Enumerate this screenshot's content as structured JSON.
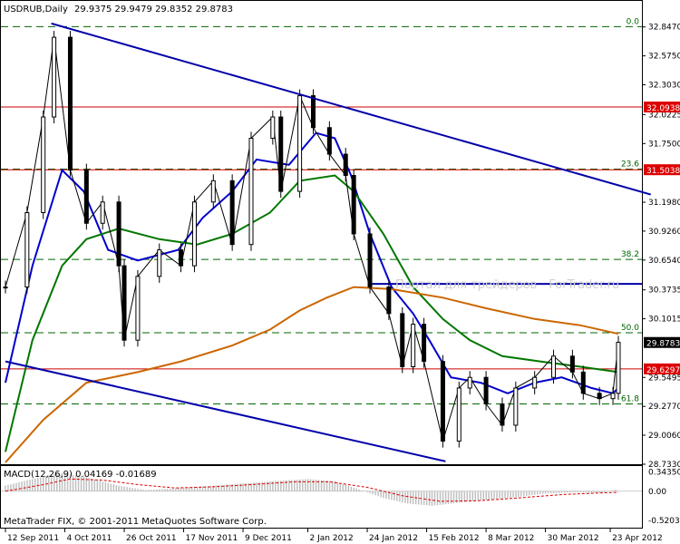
{
  "header": {
    "symbol_label": "USDRUB,Daily",
    "ohlc_label": "29.9375 29.9479 29.8352 29.8783"
  },
  "watermark": "Портал для трейдеров - ForTrader.ru",
  "footer_credit": "MetaTrader FIX, © 2001-2011 MetaQuotes Software Corp.",
  "macd_label": "MACD(12,26,9) 0.04169 -0.01689",
  "colors": {
    "background": "#ffffff",
    "frame": "#000000",
    "candle": "#000000",
    "ma_fast": "#0000cc",
    "ma_mid": "#007700",
    "ma_slow": "#cc6600",
    "channel": "#0000aa",
    "horizontal_level": "#cc0000",
    "fib_level": "#006600",
    "price_tag_red": "#dd0000",
    "price_tag_black": "#000000",
    "macd_histogram": "#c0c0c0",
    "macd_signal": "#dd0000",
    "watermark": "#cccccc"
  },
  "chart_data": {
    "type": "candlestick",
    "title": "USDRUB,Daily",
    "y_range": [
      28.733,
      32.93
    ],
    "y_axis_ticks": [
      "32.8470",
      "32.5750",
      "32.3030",
      "32.0225",
      "31.7500",
      "31.1980",
      "30.9260",
      "30.6540",
      "30.3735",
      "30.1015",
      "29.5495",
      "29.2770",
      "29.0060",
      "28.7330"
    ],
    "x_axis_ticks": [
      "12 Sep 2011",
      "4 Oct 2011",
      "26 Oct 2011",
      "17 Nov 2011",
      "9 Dec 2011",
      "2 Jan 2012",
      "24 Jan 2012",
      "15 Feb 2012",
      "8 Mar 2012",
      "30 Mar 2012",
      "23 Apr 2012"
    ],
    "price_tags": [
      {
        "label": "32.0938",
        "value": 32.0938,
        "style": "red"
      },
      {
        "label": "31.5038",
        "value": 31.5038,
        "style": "red"
      },
      {
        "label": "29.8783",
        "value": 29.8783,
        "style": "black"
      },
      {
        "label": "29.6297",
        "value": 29.6297,
        "style": "red"
      }
    ],
    "horizontal_levels": [
      32.0938,
      31.5038,
      29.6297
    ],
    "blue_support_level": 30.43,
    "fibonacci_levels": [
      {
        "label": "0.0",
        "value": 32.85
      },
      {
        "label": "23.6",
        "value": 31.51
      },
      {
        "label": "38.2",
        "value": 30.66
      },
      {
        "label": "50.0",
        "value": 29.97
      },
      {
        "label": "61.8",
        "value": 29.3
      }
    ],
    "channel_upper": {
      "from": {
        "x": "2011-09-29",
        "y": 32.88
      },
      "to": {
        "x": "2012-05-08",
        "y": 31.27
      }
    },
    "channel_lower": {
      "from": {
        "x": "2011-09-12",
        "y": 29.7
      },
      "to": {
        "x": "2012-02-22",
        "y": 28.76
      }
    },
    "close_series": [
      {
        "x": "2011-09-12",
        "y": 30.4
      },
      {
        "x": "2011-09-20",
        "y": 31.1
      },
      {
        "x": "2011-09-26",
        "y": 32.0
      },
      {
        "x": "2011-09-30",
        "y": 32.75
      },
      {
        "x": "2011-10-06",
        "y": 31.5
      },
      {
        "x": "2011-10-12",
        "y": 31.0
      },
      {
        "x": "2011-10-18",
        "y": 31.2
      },
      {
        "x": "2011-10-24",
        "y": 30.6
      },
      {
        "x": "2011-10-26",
        "y": 29.9
      },
      {
        "x": "2011-10-31",
        "y": 30.5
      },
      {
        "x": "2011-11-08",
        "y": 30.75
      },
      {
        "x": "2011-11-16",
        "y": 30.6
      },
      {
        "x": "2011-11-21",
        "y": 31.2
      },
      {
        "x": "2011-11-28",
        "y": 31.4
      },
      {
        "x": "2011-12-05",
        "y": 30.8
      },
      {
        "x": "2011-12-12",
        "y": 31.8
      },
      {
        "x": "2011-12-20",
        "y": 32.0
      },
      {
        "x": "2011-12-23",
        "y": 31.3
      },
      {
        "x": "2011-12-30",
        "y": 32.2
      },
      {
        "x": "2012-01-04",
        "y": 31.9
      },
      {
        "x": "2012-01-10",
        "y": 31.65
      },
      {
        "x": "2012-01-16",
        "y": 31.45
      },
      {
        "x": "2012-01-19",
        "y": 30.9
      },
      {
        "x": "2012-01-25",
        "y": 30.4
      },
      {
        "x": "2012-02-01",
        "y": 30.15
      },
      {
        "x": "2012-02-06",
        "y": 29.65
      },
      {
        "x": "2012-02-10",
        "y": 30.05
      },
      {
        "x": "2012-02-14",
        "y": 29.7
      },
      {
        "x": "2012-02-21",
        "y": 28.95
      },
      {
        "x": "2012-02-27",
        "y": 29.45
      },
      {
        "x": "2012-03-02",
        "y": 29.55
      },
      {
        "x": "2012-03-08",
        "y": 29.3
      },
      {
        "x": "2012-03-14",
        "y": 29.1
      },
      {
        "x": "2012-03-19",
        "y": 29.45
      },
      {
        "x": "2012-03-26",
        "y": 29.55
      },
      {
        "x": "2012-04-02",
        "y": 29.75
      },
      {
        "x": "2012-04-09",
        "y": 29.6
      },
      {
        "x": "2012-04-13",
        "y": 29.4
      },
      {
        "x": "2012-04-19",
        "y": 29.35
      },
      {
        "x": "2012-04-24",
        "y": 29.4
      },
      {
        "x": "2012-04-26",
        "y": 29.88
      }
    ],
    "series": [
      {
        "values": [
          {
            "x": "2011-09-12",
            "y": 29.5
          },
          {
            "x": "2011-09-22",
            "y": 30.6
          },
          {
            "x": "2011-10-03",
            "y": 31.5
          },
          {
            "x": "2011-10-11",
            "y": 31.3
          },
          {
            "x": "2011-10-20",
            "y": 30.75
          },
          {
            "x": "2011-10-31",
            "y": 30.65
          },
          {
            "x": "2011-11-15",
            "y": 30.75
          },
          {
            "x": "2011-11-24",
            "y": 31.05
          },
          {
            "x": "2011-12-05",
            "y": 31.3
          },
          {
            "x": "2011-12-14",
            "y": 31.6
          },
          {
            "x": "2011-12-26",
            "y": 31.55
          },
          {
            "x": "2012-01-05",
            "y": 31.85
          },
          {
            "x": "2012-01-12",
            "y": 31.8
          },
          {
            "x": "2012-01-18",
            "y": 31.45
          },
          {
            "x": "2012-01-25",
            "y": 30.9
          },
          {
            "x": "2012-02-02",
            "y": 30.4
          },
          {
            "x": "2012-02-10",
            "y": 30.15
          },
          {
            "x": "2012-02-16",
            "y": 29.9
          },
          {
            "x": "2012-02-24",
            "y": 29.55
          },
          {
            "x": "2012-03-06",
            "y": 29.5
          },
          {
            "x": "2012-03-16",
            "y": 29.4
          },
          {
            "x": "2012-03-26",
            "y": 29.5
          },
          {
            "x": "2012-04-05",
            "y": 29.55
          },
          {
            "x": "2012-04-16",
            "y": 29.45
          },
          {
            "x": "2012-04-24",
            "y": 29.4
          },
          {
            "x": "2012-04-26",
            "y": 29.45
          }
        ]
      },
      {
        "values": [
          {
            "x": "2011-09-12",
            "y": 28.85
          },
          {
            "x": "2011-09-22",
            "y": 29.9
          },
          {
            "x": "2011-10-03",
            "y": 30.6
          },
          {
            "x": "2011-10-12",
            "y": 30.85
          },
          {
            "x": "2011-10-24",
            "y": 30.95
          },
          {
            "x": "2011-11-08",
            "y": 30.85
          },
          {
            "x": "2011-11-22",
            "y": 30.8
          },
          {
            "x": "2011-12-05",
            "y": 30.9
          },
          {
            "x": "2011-12-19",
            "y": 31.1
          },
          {
            "x": "2011-12-30",
            "y": 31.4
          },
          {
            "x": "2012-01-12",
            "y": 31.45
          },
          {
            "x": "2012-01-19",
            "y": 31.3
          },
          {
            "x": "2012-01-30",
            "y": 30.9
          },
          {
            "x": "2012-02-10",
            "y": 30.4
          },
          {
            "x": "2012-02-21",
            "y": 30.1
          },
          {
            "x": "2012-03-02",
            "y": 29.9
          },
          {
            "x": "2012-03-14",
            "y": 29.75
          },
          {
            "x": "2012-03-28",
            "y": 29.7
          },
          {
            "x": "2012-04-12",
            "y": 29.65
          },
          {
            "x": "2012-04-26",
            "y": 29.6
          }
        ]
      },
      {
        "values": [
          {
            "x": "2011-09-12",
            "y": 28.75
          },
          {
            "x": "2011-09-26",
            "y": 29.15
          },
          {
            "x": "2011-10-12",
            "y": 29.5
          },
          {
            "x": "2011-10-31",
            "y": 29.6
          },
          {
            "x": "2011-11-16",
            "y": 29.7
          },
          {
            "x": "2011-12-05",
            "y": 29.85
          },
          {
            "x": "2011-12-19",
            "y": 30.0
          },
          {
            "x": "2011-12-30",
            "y": 30.18
          },
          {
            "x": "2012-01-09",
            "y": 30.3
          },
          {
            "x": "2012-01-19",
            "y": 30.4
          },
          {
            "x": "2012-02-02",
            "y": 30.38
          },
          {
            "x": "2012-02-21",
            "y": 30.3
          },
          {
            "x": "2012-03-08",
            "y": 30.2
          },
          {
            "x": "2012-03-26",
            "y": 30.1
          },
          {
            "x": "2012-04-12",
            "y": 30.04
          },
          {
            "x": "2012-04-26",
            "y": 29.96
          }
        ]
      }
    ],
    "macd": {
      "label": "MACD(12,26,9) 0.04169 -0.01689",
      "y_axis_ticks": [
        "0.34350",
        "0.00",
        "-0.52038"
      ],
      "y_range": [
        -0.62,
        0.42
      ],
      "histogram": [
        {
          "x": "2011-09-12",
          "y": 0.1
        },
        {
          "x": "2011-09-22",
          "y": 0.22
        },
        {
          "x": "2011-10-03",
          "y": 0.33
        },
        {
          "x": "2011-10-12",
          "y": 0.25
        },
        {
          "x": "2011-10-24",
          "y": 0.1
        },
        {
          "x": "2011-11-03",
          "y": 0.02
        },
        {
          "x": "2011-11-16",
          "y": 0.06
        },
        {
          "x": "2011-11-28",
          "y": 0.1
        },
        {
          "x": "2011-12-09",
          "y": 0.14
        },
        {
          "x": "2011-12-20",
          "y": 0.18
        },
        {
          "x": "2012-01-02",
          "y": 0.22
        },
        {
          "x": "2012-01-12",
          "y": 0.18
        },
        {
          "x": "2012-01-20",
          "y": 0.05
        },
        {
          "x": "2012-01-30",
          "y": -0.12
        },
        {
          "x": "2012-02-08",
          "y": -0.22
        },
        {
          "x": "2012-02-17",
          "y": -0.26
        },
        {
          "x": "2012-02-28",
          "y": -0.2
        },
        {
          "x": "2012-03-09",
          "y": -0.15
        },
        {
          "x": "2012-03-20",
          "y": -0.1
        },
        {
          "x": "2012-03-30",
          "y": -0.04
        },
        {
          "x": "2012-04-10",
          "y": -0.02
        },
        {
          "x": "2012-04-20",
          "y": -0.03
        },
        {
          "x": "2012-04-26",
          "y": 0.04
        }
      ],
      "signal": [
        {
          "x": "2011-09-12",
          "y": 0.0
        },
        {
          "x": "2011-09-26",
          "y": 0.12
        },
        {
          "x": "2011-10-06",
          "y": 0.22
        },
        {
          "x": "2011-10-18",
          "y": 0.2
        },
        {
          "x": "2011-10-31",
          "y": 0.12
        },
        {
          "x": "2011-11-14",
          "y": 0.06
        },
        {
          "x": "2011-11-28",
          "y": 0.08
        },
        {
          "x": "2011-12-12",
          "y": 0.12
        },
        {
          "x": "2011-12-28",
          "y": 0.17
        },
        {
          "x": "2012-01-10",
          "y": 0.17
        },
        {
          "x": "2012-01-24",
          "y": 0.07
        },
        {
          "x": "2012-02-06",
          "y": -0.08
        },
        {
          "x": "2012-02-20",
          "y": -0.18
        },
        {
          "x": "2012-03-05",
          "y": -0.17
        },
        {
          "x": "2012-03-20",
          "y": -0.12
        },
        {
          "x": "2012-04-05",
          "y": -0.06
        },
        {
          "x": "2012-04-19",
          "y": -0.03
        },
        {
          "x": "2012-04-26",
          "y": -0.02
        }
      ]
    }
  }
}
